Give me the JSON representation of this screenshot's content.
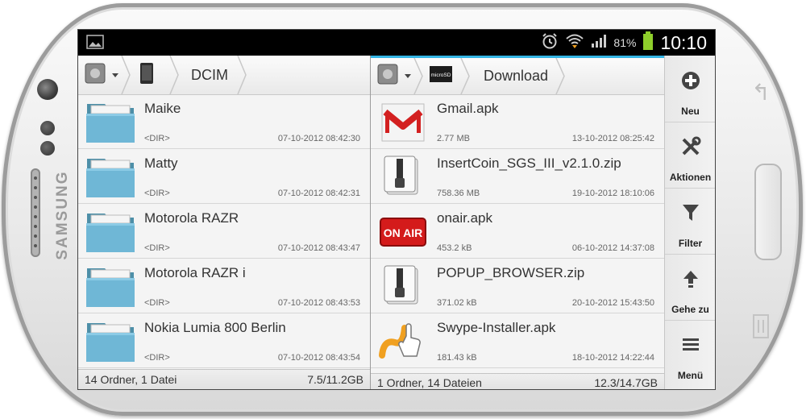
{
  "device": {
    "brand": "SAMSUNG"
  },
  "status_bar": {
    "battery_percent": "81%",
    "time": "10:10"
  },
  "left_pane": {
    "breadcrumbs": [
      "DCIM"
    ],
    "items": [
      {
        "name": "Maike",
        "meta": "<DIR>",
        "date": "07-10-2012 08:42:30",
        "icon": "folder-icon"
      },
      {
        "name": "Matty",
        "meta": "<DIR>",
        "date": "07-10-2012 08:42:31",
        "icon": "folder-icon"
      },
      {
        "name": "Motorola RAZR",
        "meta": "<DIR>",
        "date": "07-10-2012 08:43:47",
        "icon": "folder-icon"
      },
      {
        "name": "Motorola RAZR i",
        "meta": "<DIR>",
        "date": "07-10-2012 08:43:53",
        "icon": "folder-icon"
      },
      {
        "name": "Nokia Lumia 800 Berlin",
        "meta": "<DIR>",
        "date": "07-10-2012 08:43:54",
        "icon": "folder-icon"
      }
    ],
    "footer": {
      "summary": "14 Ordner, 1 Datei",
      "storage": "7.5/11.2GB"
    }
  },
  "right_pane": {
    "breadcrumbs": [
      "Download"
    ],
    "sd_label": "microSD",
    "items": [
      {
        "name": "Gmail.apk",
        "meta": "2.77 MB",
        "date": "13-10-2012 08:25:42",
        "icon": "gmail-icon"
      },
      {
        "name": "InsertCoin_SGS_III_v2.1.0.zip",
        "meta": "758.36 MB",
        "date": "19-10-2012 18:10:06",
        "icon": "zip-icon"
      },
      {
        "name": "onair.apk",
        "meta": "453.2 kB",
        "date": "06-10-2012 14:37:08",
        "icon": "on-air-icon",
        "icon_text": "ON AIR"
      },
      {
        "name": "POPUP_BROWSER.zip",
        "meta": "371.02 kB",
        "date": "20-10-2012 15:43:50",
        "icon": "zip-icon"
      },
      {
        "name": "Swype-Installer.apk",
        "meta": "181.43 kB",
        "date": "18-10-2012 14:22:44",
        "icon": "swype-icon"
      }
    ],
    "footer": {
      "summary": "1 Ordner, 14 Dateien",
      "storage": "12.3/14.7GB"
    }
  },
  "actions": [
    {
      "label": "Neu",
      "icon": "plus-circle-icon"
    },
    {
      "label": "Aktionen",
      "icon": "tools-icon"
    },
    {
      "label": "Filter",
      "icon": "filter-icon"
    },
    {
      "label": "Gehe zu",
      "icon": "arrow-up-icon"
    },
    {
      "label": "Menü",
      "icon": "menu-icon"
    }
  ],
  "colors": {
    "accent": "#33b5e5",
    "folder": "#6fb7d6",
    "statusbar": "#000000",
    "battery": "#8ecf2b"
  }
}
